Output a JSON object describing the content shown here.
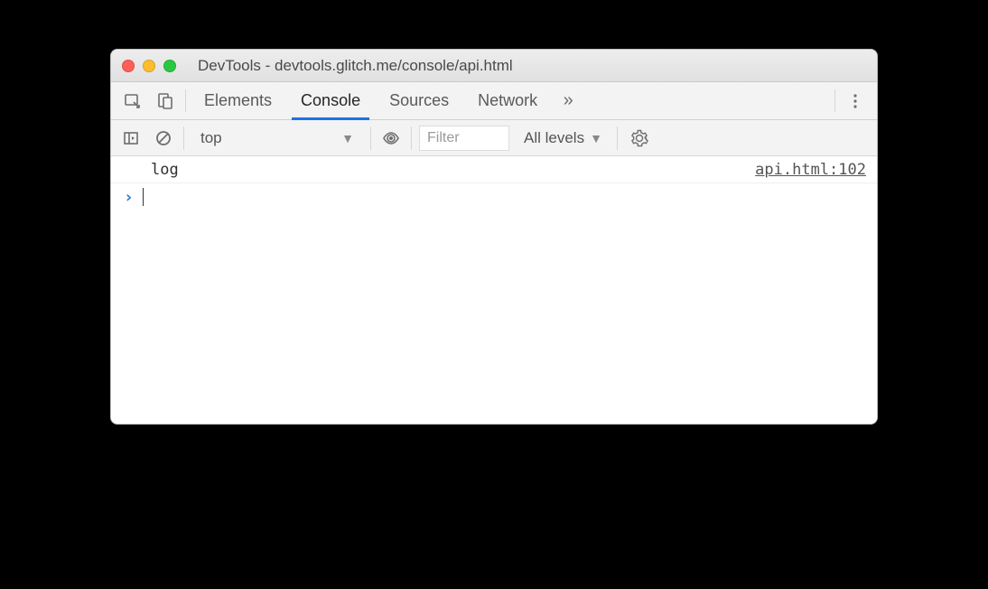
{
  "window": {
    "title": "DevTools - devtools.glitch.me/console/api.html"
  },
  "tabs": {
    "items": [
      "Elements",
      "Console",
      "Sources",
      "Network"
    ],
    "active_index": 1,
    "overflow_glyph": "»"
  },
  "toolbar": {
    "context": "top",
    "filter_placeholder": "Filter",
    "levels_label": "All levels"
  },
  "console": {
    "entries": [
      {
        "message": "log",
        "source": "api.html:102"
      }
    ],
    "prompt_glyph": "›"
  }
}
